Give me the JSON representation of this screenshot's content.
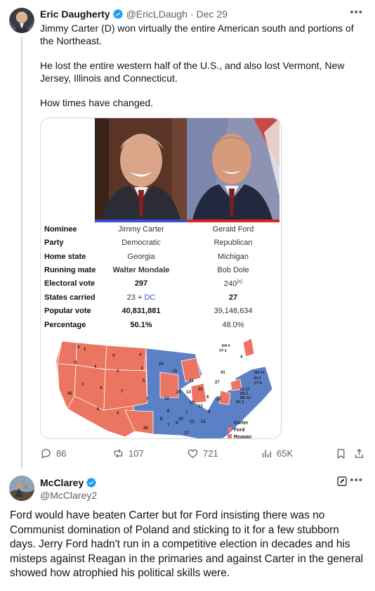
{
  "tweet1": {
    "author_name": "Eric Daugherty",
    "handle": "@EricLDaugh",
    "separator": "·",
    "date": "Dec 29",
    "lines": [
      "Jimmy Carter (D) won virtually the entire American south and portions of the Northeast.",
      "He lost the entire western half of the U.S., and also lost Vermont, New Jersey, Illinois and Connecticut.",
      "How times have changed."
    ],
    "stats": {
      "replies": "86",
      "retweets": "107",
      "likes": "721",
      "views": "65K"
    }
  },
  "infobox": {
    "rows": [
      {
        "label": "Nominee",
        "carter": "Jimmy Carter",
        "ford": "Gerald Ford"
      },
      {
        "label": "Party",
        "carter": "Democratic",
        "ford": "Republican"
      },
      {
        "label": "Home state",
        "carter": "Georgia",
        "ford": "Michigan"
      },
      {
        "label": "Running mate",
        "carter": "Walter Mondale",
        "ford": "Bob Dole"
      },
      {
        "label": "Electoral vote",
        "carter": "297",
        "ford": "240",
        "ford_note": "[a]"
      },
      {
        "label": "States carried",
        "carter": "23 + ",
        "carter_link": "DC",
        "ford": "27"
      },
      {
        "label": "Popular vote",
        "carter": "40,831,881",
        "ford": "39,148,634"
      },
      {
        "label": "Percentage",
        "carter": "50.1%",
        "ford": "48.0%"
      }
    ],
    "colors": {
      "carter": "#3a4fd6",
      "ford": "#dc2427",
      "map_blue": "#5c80c6",
      "map_red": "#ec7561"
    },
    "map": {
      "west_labels": [
        "8",
        "1",
        "4",
        "4",
        "6",
        "4",
        "3",
        "4",
        "3",
        "3",
        "4",
        "7",
        "5",
        "45",
        "6",
        "7",
        "4",
        "8",
        "10"
      ],
      "east_labels": [
        "10",
        "11",
        "21",
        "26",
        "13",
        "25",
        "27",
        "41",
        "17",
        "12",
        "9",
        "12",
        "6",
        "6",
        "7",
        "9",
        "12",
        "10",
        "13",
        "8",
        "26",
        "17"
      ],
      "northeast_labels": [
        "NH 4",
        "VT 3",
        "4",
        "MA 14",
        "RI 4",
        "CT 8",
        "NJ 17",
        "DE 3",
        "MD 10",
        "DC 3"
      ],
      "legend": [
        "Carter",
        "Ford",
        "Reagan"
      ]
    }
  },
  "tweet2": {
    "author_name": "McClarey",
    "handle": "@McClarey2",
    "text": "Ford would have beaten Carter but for Ford insisting there was no Communist domination of Poland and sticking to it for a few stubborn days.  Jerry Ford hadn't run in a competitive election in decades and his misteps against Reagan in the primaries and against Carter in the general showed how atrophied his political skills were."
  }
}
